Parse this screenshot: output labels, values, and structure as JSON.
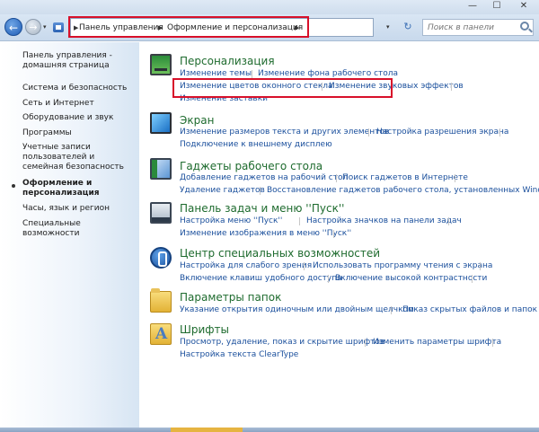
{
  "window": {
    "minimize_glyph": "—",
    "maximize_glyph": "☐",
    "close_glyph": "✕"
  },
  "nav": {
    "back_glyph": "←",
    "forward_glyph": "→",
    "recent_glyph": "▾",
    "breadcrumb": [
      "Панель управления",
      "Оформление и персонализация"
    ],
    "crumb_separator": "▶",
    "address_dropdown_glyph": "▾",
    "refresh_glyph": "↻",
    "search_placeholder": "Поиск в панели"
  },
  "sidebar": {
    "home": "Панель управления - домашняя страница",
    "items": [
      "Система и безопасность",
      "Сеть и Интернет",
      "Оборудование и звук",
      "Программы",
      "Учетные записи пользователей и семейная безопасность",
      "Оформление и персонализация",
      "Часы, язык и регион",
      "Специальные возможности"
    ],
    "current_index": 5
  },
  "sections": [
    {
      "icon": "personalization-icon",
      "title": "Персонализация",
      "links": [
        "Изменение темы",
        "Изменение фона рабочего стола",
        "Изменение цветов оконного стекла",
        "Изменение звуковых эффектов",
        "Изменение заставки"
      ]
    },
    {
      "icon": "display-icon",
      "title": "Экран",
      "links": [
        "Изменение размеров текста и других элементов",
        "Настройка разрешения экрана",
        "Подключение к внешнему дисплею"
      ]
    },
    {
      "icon": "gadgets-icon",
      "title": "Гаджеты рабочего стола",
      "links": [
        "Добавление гаджетов на рабочий стол",
        "Поиск гаджетов в Интернете",
        "Удаление гаджетов",
        "Восстановление гаджетов рабочего стола, установленных Windows"
      ]
    },
    {
      "icon": "taskbar-icon",
      "title": "Панель задач и меню ''Пуск''",
      "links": [
        "Настройка меню ''Пуск''",
        "Настройка значков на панели задач",
        "Изменение изображения в меню ''Пуск''"
      ]
    },
    {
      "icon": "accessibility-icon",
      "title": "Центр специальных возможностей",
      "links": [
        "Настройка для слабого зрения",
        "Использовать программу чтения с экрана",
        "Включение клавиш удобного доступа",
        "Включение высокой контрастности"
      ]
    },
    {
      "icon": "folder-options-icon",
      "title": "Параметры папок",
      "links": [
        "Указание открытия одиночным или двойным щелчком",
        "Показ скрытых файлов и папок"
      ]
    },
    {
      "icon": "fonts-icon",
      "title": "Шрифты",
      "links": [
        "Просмотр, удаление, показ и скрытие шрифтов",
        "Изменить параметры шрифта",
        "Настройка текста ClearType"
      ]
    }
  ]
}
